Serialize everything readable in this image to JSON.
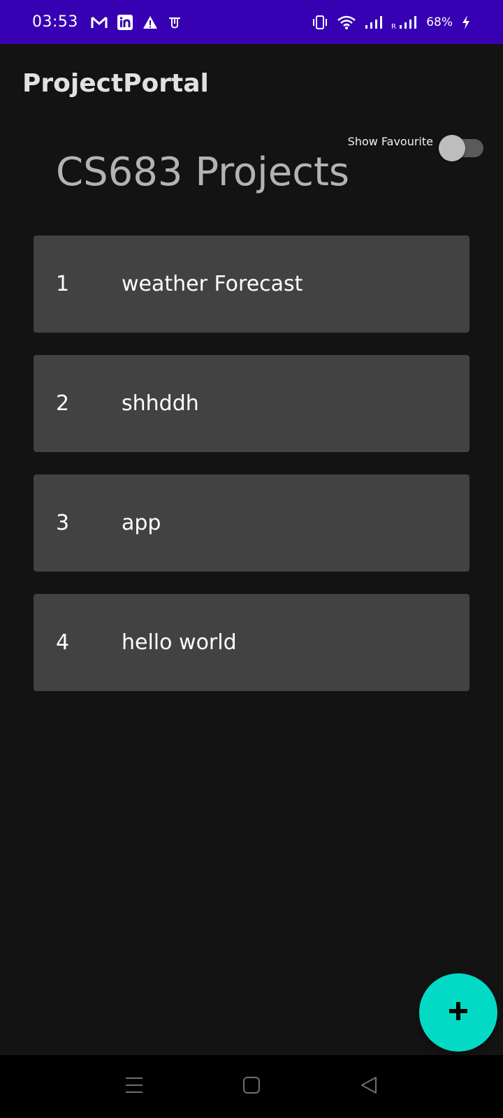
{
  "status_bar": {
    "time": "03:53",
    "notification_icons": [
      "gmail-icon",
      "linkedin-icon",
      "warning-icon",
      "app-icon"
    ],
    "system_icons": [
      "vibrate-icon",
      "wifi-icon",
      "signal-icon",
      "signal-roaming-icon",
      "charging-icon"
    ],
    "battery": "68%",
    "roaming_label": "R",
    "background_color": "#3700b3"
  },
  "app_bar": {
    "title": "ProjectPortal"
  },
  "favourite_toggle": {
    "label": "Show Favourite",
    "checked": false
  },
  "heading": "CS683 Projects",
  "projects": [
    {
      "id": "1",
      "name": "weather Forecast"
    },
    {
      "id": "2",
      "name": "shhddh"
    },
    {
      "id": "3",
      "name": "app"
    },
    {
      "id": "4",
      "name": "hello world"
    }
  ],
  "fab": {
    "icon": "plus-icon",
    "color": "#03dac5"
  },
  "nav_bar": {
    "buttons": [
      "menu-icon",
      "home-icon",
      "back-icon"
    ]
  }
}
